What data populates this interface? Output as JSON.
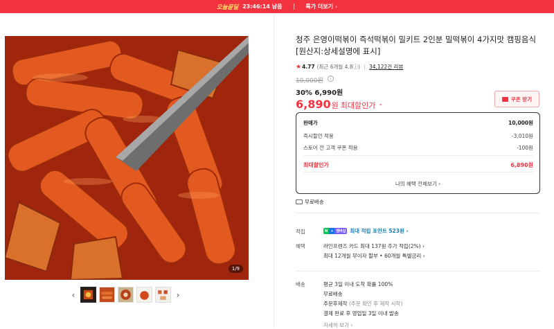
{
  "topbar": {
    "brand": "오늘끝딜",
    "timer": "23:46:14 남음",
    "more_label": "특가 더보기",
    "more_chevron": "›"
  },
  "gallery": {
    "counter": "1/9",
    "prev_icon": "‹",
    "next_icon": "›",
    "thumb_count": 5,
    "active_thumb": 0
  },
  "product": {
    "title": "청주 은영이떡볶이 즉석떡볶이 밀키트 2인분 밀떡볶이 4가지맛 캠핑음식 [원산지:상세설명에 표시]",
    "rating": "4.77",
    "rating_sub": "(최근 6개월 4.8ⓘ)",
    "reviews": "34,122건 리뷰",
    "original_price": "10,000원",
    "discount_rate": "30%",
    "discount_price": "6,990원",
    "max_price": "6,890",
    "max_unit": "원",
    "max_label": "최대할인가",
    "max_caret": "⌃",
    "coupon_label": "쿠폰 받기"
  },
  "price_box": {
    "rows": [
      {
        "label": "판매가",
        "value": "10,000원"
      },
      {
        "label": "즉시할인 적용",
        "value": "-3,010원"
      },
      {
        "label": "스토어 전 고객 쿠폰 적용",
        "value": "-100원"
      }
    ],
    "final_label": "최대할인가",
    "final_value": "6,890원",
    "view_all": "나의 혜택 전체보기 ›"
  },
  "shipping_badge": "무료배송",
  "benefits": {
    "point_label": "적립",
    "point_badge": [
      "N",
      "+",
      "멤버십"
    ],
    "point_link": "최대 적립 포인트 523원 ›",
    "benefit_label": "혜택",
    "benefit_line1": "라인프렌즈 카드 최대 137원 추가 적립(2%) ›",
    "benefit_line2": "최대 12개월 무이자 할부 • 60개월 특별금리 ›"
  },
  "delivery": {
    "label": "배송",
    "line1": "평균 3일 이내 도착 확률 100%",
    "line2": "무료배송",
    "line3_main": "주문후제작",
    "line3_sub": " (주문 확인 후 제작 시작)",
    "line4": "결제 완료 후 영업일 3일 이내 발송",
    "more": "자세히 보기 ›"
  },
  "colors": {
    "accent": "#f2323f",
    "topbar_bg": "#f2323f",
    "brand_yellow": "#ffe36b",
    "link_blue": "#1a7fb8",
    "naver_green": "#03c75a"
  }
}
